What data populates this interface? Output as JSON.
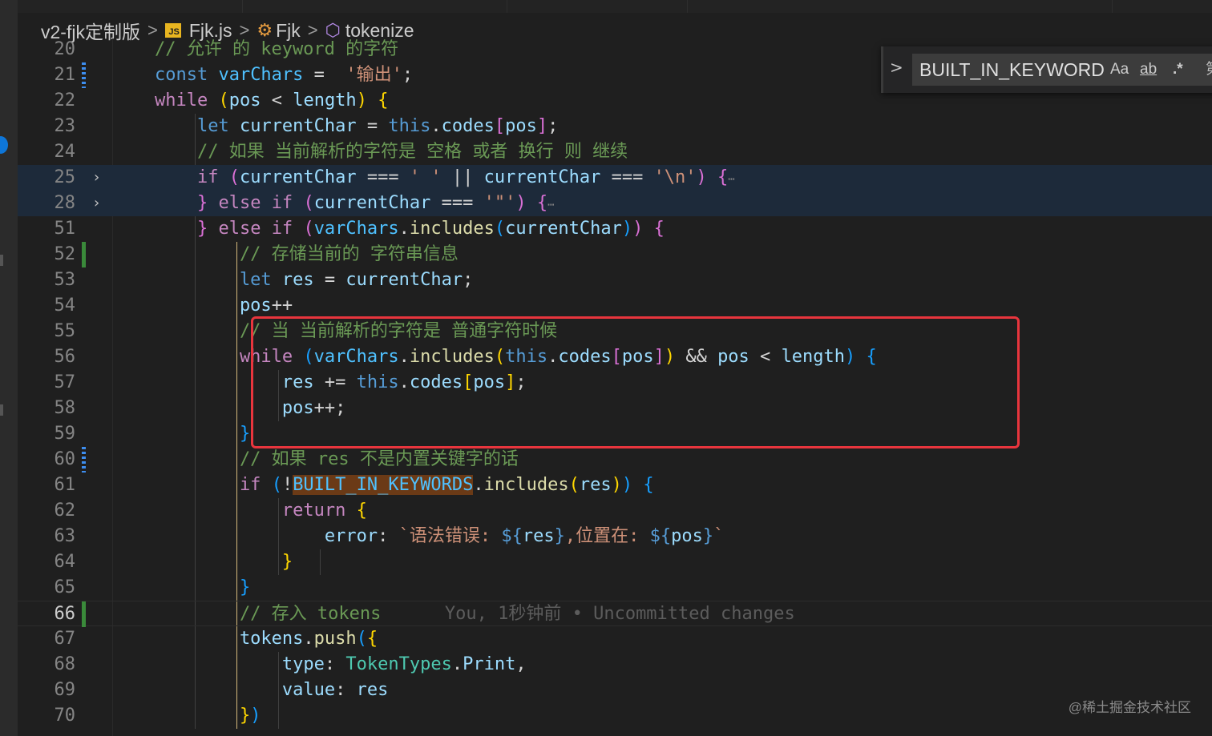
{
  "breadcrumb": {
    "folder": "v2-fjk定制版",
    "file": "Fjk.js",
    "file_icon": "JS",
    "class": "Fjk",
    "method": "tokenize"
  },
  "find_widget": {
    "query": "BUILT_IN_KEYWORDS",
    "opt_case": "Aa",
    "opt_word": "ab",
    "opt_regex": ".*",
    "cut_char": "第"
  },
  "blame": "You, 1秒钟前 • Uncommitted changes",
  "watermark": "@稀土掘金技术社区",
  "colors": {
    "keyword": "#569cd6",
    "control": "#c586c0",
    "string": "#ce9178",
    "comment": "#6a9955",
    "variable": "#9cdcfe",
    "function": "#dcdcaa",
    "type": "#4ec9b0",
    "highlight_box": "#e8353d"
  },
  "lines": [
    {
      "n": "20",
      "t": [
        [
          "cm",
          "    // 允许 的 keyword 的字符"
        ]
      ]
    },
    {
      "n": "21",
      "t": [
        [
          "kw",
          "    const "
        ],
        [
          "cn",
          "varChars"
        ],
        [
          "pl",
          " =  "
        ],
        [
          "str",
          "'输出'"
        ],
        [
          "pl",
          ";"
        ]
      ]
    },
    {
      "n": "22",
      "t": [
        [
          "ctl",
          "    while "
        ],
        [
          "b1",
          "("
        ],
        [
          "vr",
          "pos"
        ],
        [
          "pl",
          " < "
        ],
        [
          "vr",
          "length"
        ],
        [
          "b1",
          ")"
        ],
        [
          "pl",
          " "
        ],
        [
          "b1",
          "{"
        ]
      ]
    },
    {
      "n": "23",
      "t": [
        [
          "kw",
          "        let "
        ],
        [
          "vr",
          "currentChar"
        ],
        [
          "pl",
          " = "
        ],
        [
          "kw",
          "this"
        ],
        [
          "pl",
          "."
        ],
        [
          "vr",
          "codes"
        ],
        [
          "b2",
          "["
        ],
        [
          "vr",
          "pos"
        ],
        [
          "b2",
          "]"
        ],
        [
          "pl",
          ";"
        ]
      ]
    },
    {
      "n": "24",
      "t": [
        [
          "cm",
          "        // 如果 当前解析的字符是 空格 或者 换行 则 继续"
        ]
      ]
    },
    {
      "n": "25",
      "t": [
        [
          "ctl",
          "        if "
        ],
        [
          "b2",
          "("
        ],
        [
          "vr",
          "currentChar"
        ],
        [
          "pl",
          " === "
        ],
        [
          "str",
          "' '"
        ],
        [
          "pl",
          " || "
        ],
        [
          "vr",
          "currentChar"
        ],
        [
          "pl",
          " === "
        ],
        [
          "str",
          "'\\n'"
        ],
        [
          "b2",
          ")"
        ],
        [
          "pl",
          " "
        ],
        [
          "b2",
          "{"
        ],
        [
          "ell",
          "⋯"
        ]
      ]
    },
    {
      "n": "28",
      "t": [
        [
          "b2",
          "        }"
        ],
        [
          "ctl",
          " else if "
        ],
        [
          "b2",
          "("
        ],
        [
          "vr",
          "currentChar"
        ],
        [
          "pl",
          " === "
        ],
        [
          "str",
          "'\"'"
        ],
        [
          "b2",
          ")"
        ],
        [
          "pl",
          " "
        ],
        [
          "b2",
          "{"
        ],
        [
          "ell",
          "⋯"
        ]
      ]
    },
    {
      "n": "51",
      "t": [
        [
          "b2",
          "        }"
        ],
        [
          "ctl",
          " else if "
        ],
        [
          "b2",
          "("
        ],
        [
          "cn",
          "varChars"
        ],
        [
          "pl",
          "."
        ],
        [
          "fn",
          "includes"
        ],
        [
          "b3",
          "("
        ],
        [
          "vr",
          "currentChar"
        ],
        [
          "b3",
          ")"
        ],
        [
          "b2",
          ")"
        ],
        [
          "pl",
          " "
        ],
        [
          "b2",
          "{"
        ]
      ]
    },
    {
      "n": "52",
      "t": [
        [
          "cm",
          "            // 存储当前的 字符串信息"
        ]
      ]
    },
    {
      "n": "53",
      "t": [
        [
          "kw",
          "            let "
        ],
        [
          "vr",
          "res"
        ],
        [
          "pl",
          " = "
        ],
        [
          "vr",
          "currentChar"
        ],
        [
          "pl",
          ";"
        ]
      ]
    },
    {
      "n": "54",
      "t": [
        [
          "vr",
          "            pos"
        ],
        [
          "pl",
          "++"
        ]
      ]
    },
    {
      "n": "55",
      "t": [
        [
          "cm",
          "            // 当 当前解析的字符是 普通字符时候"
        ]
      ]
    },
    {
      "n": "56",
      "t": [
        [
          "ctl",
          "            while "
        ],
        [
          "b3",
          "("
        ],
        [
          "cn",
          "varChars"
        ],
        [
          "pl",
          "."
        ],
        [
          "fn",
          "includes"
        ],
        [
          "b1",
          "("
        ],
        [
          "kw",
          "this"
        ],
        [
          "pl",
          "."
        ],
        [
          "vr",
          "codes"
        ],
        [
          "b2",
          "["
        ],
        [
          "vr",
          "pos"
        ],
        [
          "b2",
          "]"
        ],
        [
          "b1",
          ")"
        ],
        [
          "pl",
          " && "
        ],
        [
          "vr",
          "pos"
        ],
        [
          "pl",
          " < "
        ],
        [
          "vr",
          "length"
        ],
        [
          "b3",
          ")"
        ],
        [
          "pl",
          " "
        ],
        [
          "b3",
          "{"
        ]
      ]
    },
    {
      "n": "57",
      "t": [
        [
          "vr",
          "                res"
        ],
        [
          "pl",
          " += "
        ],
        [
          "kw",
          "this"
        ],
        [
          "pl",
          "."
        ],
        [
          "vr",
          "codes"
        ],
        [
          "b1",
          "["
        ],
        [
          "vr",
          "pos"
        ],
        [
          "b1",
          "]"
        ],
        [
          "pl",
          ";"
        ]
      ]
    },
    {
      "n": "58",
      "t": [
        [
          "vr",
          "                pos"
        ],
        [
          "pl",
          "++;"
        ]
      ]
    },
    {
      "n": "59",
      "t": [
        [
          "b3",
          "            }"
        ]
      ]
    },
    {
      "n": "60",
      "t": [
        [
          "cm",
          "            // 如果 res 不是内置关键字的话"
        ]
      ]
    },
    {
      "n": "61",
      "t": [
        [
          "ctl",
          "            if "
        ],
        [
          "b3",
          "("
        ],
        [
          "pl",
          "!"
        ],
        [
          "cn hl",
          "BUILT_IN_KEYWORDS"
        ],
        [
          "pl",
          "."
        ],
        [
          "fn",
          "includes"
        ],
        [
          "b1",
          "("
        ],
        [
          "vr",
          "res"
        ],
        [
          "b1",
          ")"
        ],
        [
          "b3",
          ")"
        ],
        [
          "pl",
          " "
        ],
        [
          "b3",
          "{"
        ]
      ]
    },
    {
      "n": "62",
      "t": [
        [
          "ctl",
          "                return "
        ],
        [
          "b1",
          "{"
        ]
      ]
    },
    {
      "n": "63",
      "t": [
        [
          "vr",
          "                    error"
        ],
        [
          "pl",
          ": "
        ],
        [
          "str",
          "`语法错误: "
        ],
        [
          "kw",
          "${"
        ],
        [
          "vr",
          "res"
        ],
        [
          "kw",
          "}"
        ],
        [
          "str",
          ",位置在: "
        ],
        [
          "kw",
          "${"
        ],
        [
          "vr",
          "pos"
        ],
        [
          "kw",
          "}"
        ],
        [
          "str",
          "`"
        ]
      ]
    },
    {
      "n": "64",
      "t": [
        [
          "b1",
          "                }"
        ]
      ]
    },
    {
      "n": "65",
      "t": [
        [
          "b3",
          "            }"
        ]
      ]
    },
    {
      "n": "66",
      "t": [
        [
          "cm",
          "            // 存入 tokens"
        ]
      ]
    },
    {
      "n": "67",
      "t": [
        [
          "vr",
          "            tokens"
        ],
        [
          "pl",
          "."
        ],
        [
          "fn",
          "push"
        ],
        [
          "b3",
          "("
        ],
        [
          "b1",
          "{"
        ]
      ]
    },
    {
      "n": "68",
      "t": [
        [
          "vr",
          "                type"
        ],
        [
          "pl",
          ": "
        ],
        [
          "ty",
          "TokenTypes"
        ],
        [
          "pl",
          "."
        ],
        [
          "vr",
          "Print"
        ],
        [
          "pl",
          ","
        ]
      ]
    },
    {
      "n": "69",
      "t": [
        [
          "vr",
          "                value"
        ],
        [
          "pl",
          ": "
        ],
        [
          "vr",
          "res"
        ]
      ]
    },
    {
      "n": "70",
      "t": [
        [
          "b1",
          "            }"
        ],
        [
          "b3",
          ")"
        ]
      ]
    }
  ]
}
